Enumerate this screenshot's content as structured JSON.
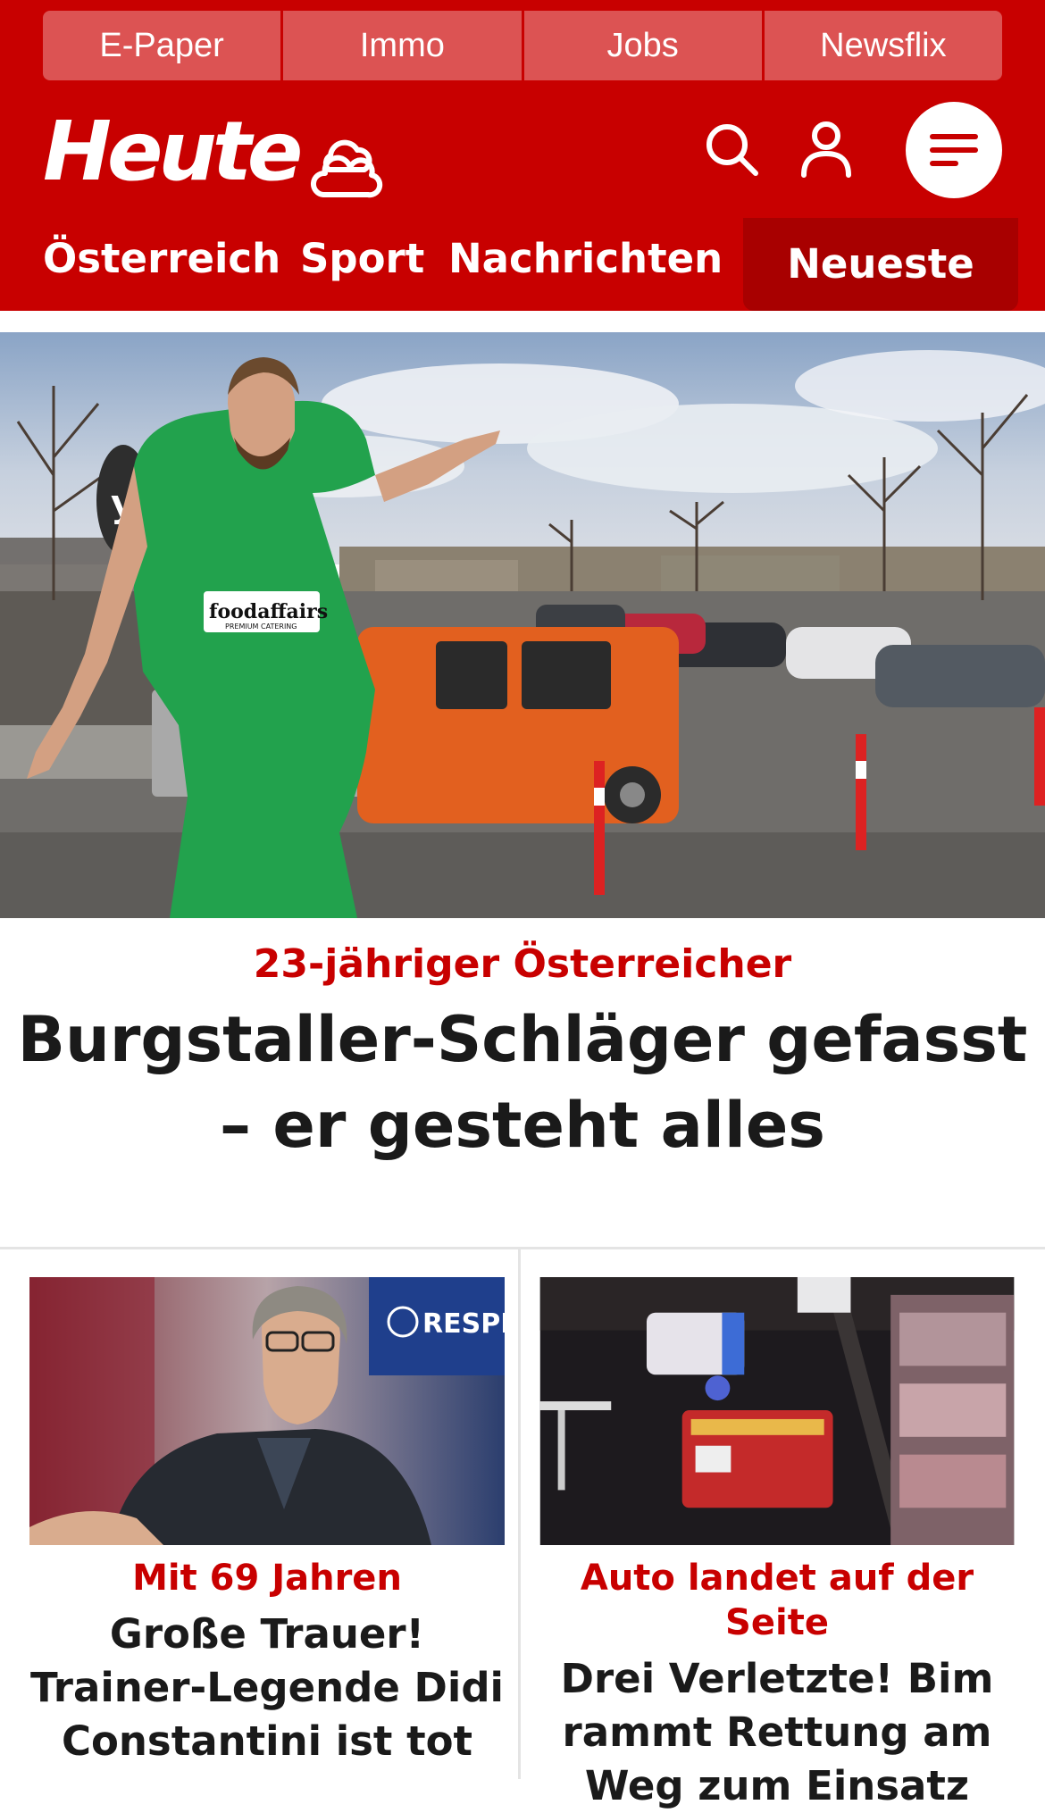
{
  "topnav": {
    "items": [
      {
        "label": "E-Paper"
      },
      {
        "label": "Immo"
      },
      {
        "label": "Jobs"
      },
      {
        "label": "Newsflix"
      }
    ]
  },
  "header": {
    "logo_text": "Heute",
    "icons": {
      "weather": "weather-cloud-icon",
      "search": "search-icon",
      "account": "user-icon",
      "menu": "menu-icon"
    }
  },
  "sections": [
    {
      "label": "Österreich"
    },
    {
      "label": "Sport"
    },
    {
      "label": "Nachrichten"
    },
    {
      "label": "Neueste",
      "active": true
    }
  ],
  "hero": {
    "kicker": "23-jähriger Österreicher",
    "headline": "Burgstaller-Schläger gefasst – er gesteht alles",
    "image": {
      "shirt_text": "foodaffairs",
      "shirt_subtext": "PREMIUM CATERING"
    }
  },
  "cards": [
    {
      "kicker": "Mit 69 Jahren",
      "headline": "Große Trauer! Trainer-Legende Didi Constantini ist tot",
      "image": {
        "banner_text": "RESPECT"
      }
    },
    {
      "kicker": "Auto landet auf der Seite",
      "headline": "Drei Verletzte! Bim rammt Rettung am Weg zum Einsatz"
    }
  ],
  "colors": {
    "brand": "#c80000",
    "brand_dark": "#a80000",
    "topnav_bg": "#dc5353",
    "headline": "#1a1a1a"
  }
}
